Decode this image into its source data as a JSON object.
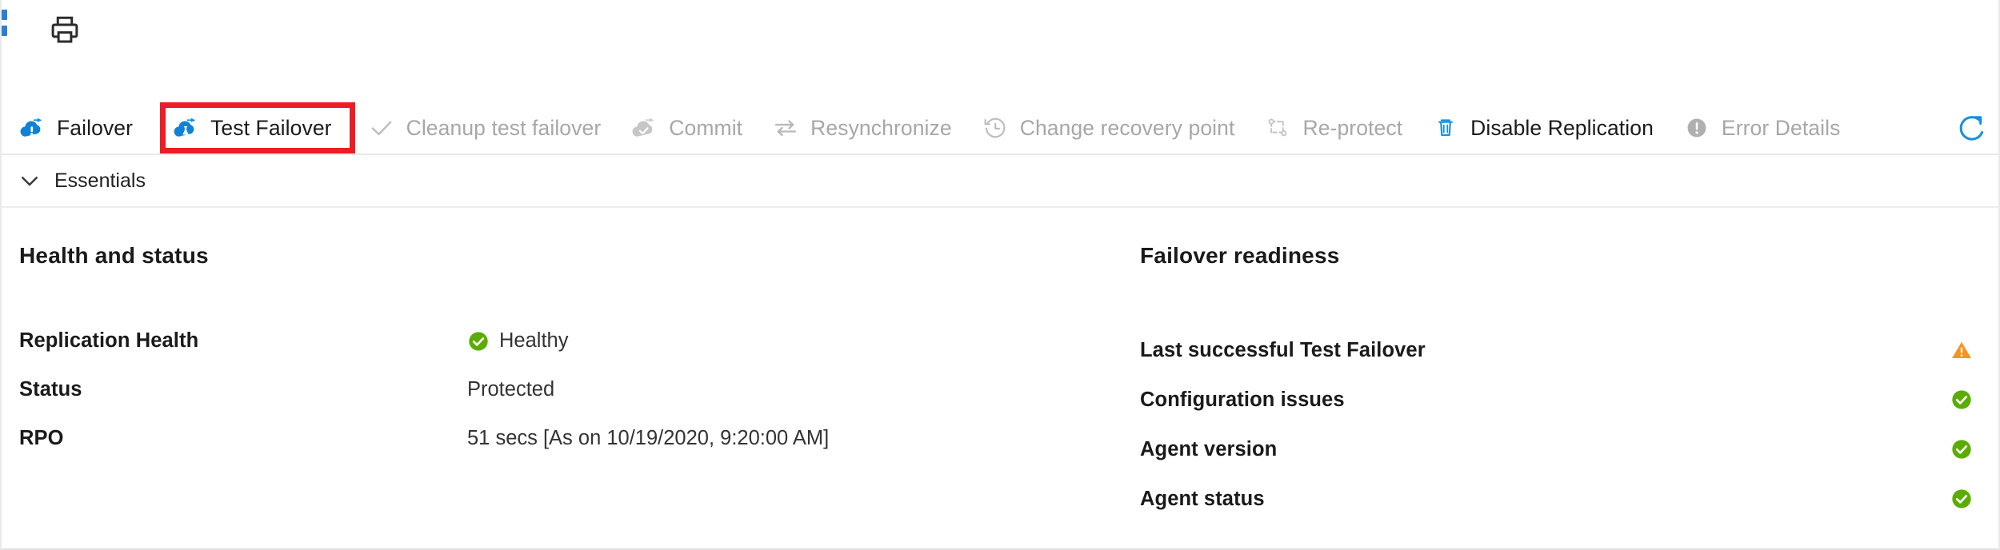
{
  "top_bar": {
    "print_icon": "printer-icon"
  },
  "command_bar": {
    "commands": [
      {
        "id": "failover",
        "label": "Failover",
        "icon": "cloud-failover-icon",
        "enabled": true
      },
      {
        "id": "test-failover",
        "label": "Test Failover",
        "icon": "cloud-test-failover-icon",
        "enabled": true,
        "highlighted": true
      },
      {
        "id": "cleanup-test-failover",
        "label": "Cleanup test failover",
        "icon": "checkmark-icon",
        "enabled": false
      },
      {
        "id": "commit",
        "label": "Commit",
        "icon": "cloud-commit-icon",
        "enabled": false
      },
      {
        "id": "resynchronize",
        "label": "Resynchronize",
        "icon": "sync-arrows-icon",
        "enabled": false
      },
      {
        "id": "change-recovery-point",
        "label": "Change recovery point",
        "icon": "clock-history-icon",
        "enabled": false
      },
      {
        "id": "re-protect",
        "label": "Re-protect",
        "icon": "reprotect-icon",
        "enabled": false
      },
      {
        "id": "disable-replication",
        "label": "Disable Replication",
        "icon": "trash-icon",
        "enabled": true
      },
      {
        "id": "error-details",
        "label": "Error Details",
        "icon": "error-circle-icon",
        "enabled": false
      }
    ],
    "refresh_icon": "refresh-icon",
    "highlight_color": "#ee1c24"
  },
  "essentials": {
    "label": "Essentials",
    "chevron_icon": "chevron-down-icon",
    "expanded": true
  },
  "health_and_status": {
    "title": "Health and status",
    "rows": [
      {
        "key": "Replication Health",
        "value": "Healthy",
        "status": "success"
      },
      {
        "key": "Status",
        "value": "Protected",
        "status": "none"
      },
      {
        "key": "RPO",
        "value": "51 secs [As on 10/19/2020, 9:20:00 AM]",
        "status": "none"
      }
    ]
  },
  "failover_readiness": {
    "title": "Failover readiness",
    "rows": [
      {
        "key": "Last successful Test Failover",
        "status": "warning"
      },
      {
        "key": "Configuration issues",
        "status": "success"
      },
      {
        "key": "Agent version",
        "status": "success"
      },
      {
        "key": "Agent status",
        "status": "success"
      }
    ]
  },
  "colors": {
    "accent_blue": "#0078d4",
    "success_green": "#5aad00",
    "warning_orange": "#f7941e",
    "disabled_gray": "#a7a7a7",
    "highlight_red": "#ee1c24"
  }
}
